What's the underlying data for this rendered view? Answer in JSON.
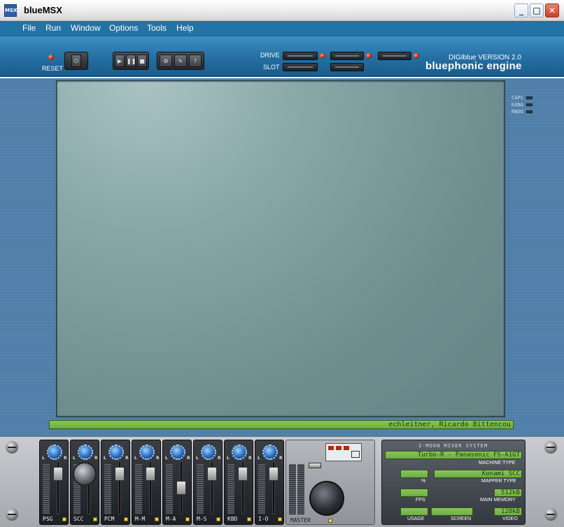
{
  "window": {
    "title": "blueMSX",
    "icon_text": "MSX",
    "minimize": "_",
    "maximize": "□",
    "close": "✕"
  },
  "menu": [
    "File",
    "Run",
    "Window",
    "Options",
    "Tools",
    "Help"
  ],
  "toolbar": {
    "reset_label": "RESET",
    "drive_label": "DRIVE",
    "slot_label": "SLOT",
    "run_buttons": [
      "▶",
      "❚❚",
      "■"
    ],
    "tool_buttons": [
      "⚙",
      "✎",
      "?"
    ],
    "brand_version": "DIGIblue VERSION 2.0",
    "brand_engine": "bluephonic engine"
  },
  "indicators": [
    "CAPS",
    "KANA",
    "RBOO"
  ],
  "status_scroll": "echleitner, Ricardo Bittencou",
  "mixer": {
    "channels": [
      {
        "label": "PSG",
        "level": 0.85
      },
      {
        "label": "SCC",
        "level": 0.85
      },
      {
        "label": "PCM",
        "level": 0.85
      },
      {
        "label": "M-M",
        "level": 0.85
      },
      {
        "label": "M-A",
        "level": 0.5
      },
      {
        "label": "M-S",
        "level": 0.85
      },
      {
        "label": "KBD",
        "level": 0.85
      },
      {
        "label": "I-O",
        "level": 0.85
      }
    ],
    "knob_left": "L",
    "knob_right": "R",
    "master_label": "MASTER"
  },
  "sysinfo": {
    "title": "2-MOON MIXER SYSTEM",
    "machine_value": "Turbo-R - Panasonic FS-A1GT",
    "machine_label": "MACHINE TYPE",
    "percent_value": "",
    "percent_label": "%",
    "mapper_value": "Konami SCC",
    "mapper_label": "MAPPER TYPE",
    "fps_value": "",
    "fps_label": "FPS",
    "memory_value": "512kB",
    "memory_label": "MAIN MEMORY",
    "usage_value": "",
    "usage_label": "USAGE",
    "screen_value": "",
    "screen_label": "SCREEN",
    "video_value": "128kB",
    "video_label": "VIDEO"
  }
}
